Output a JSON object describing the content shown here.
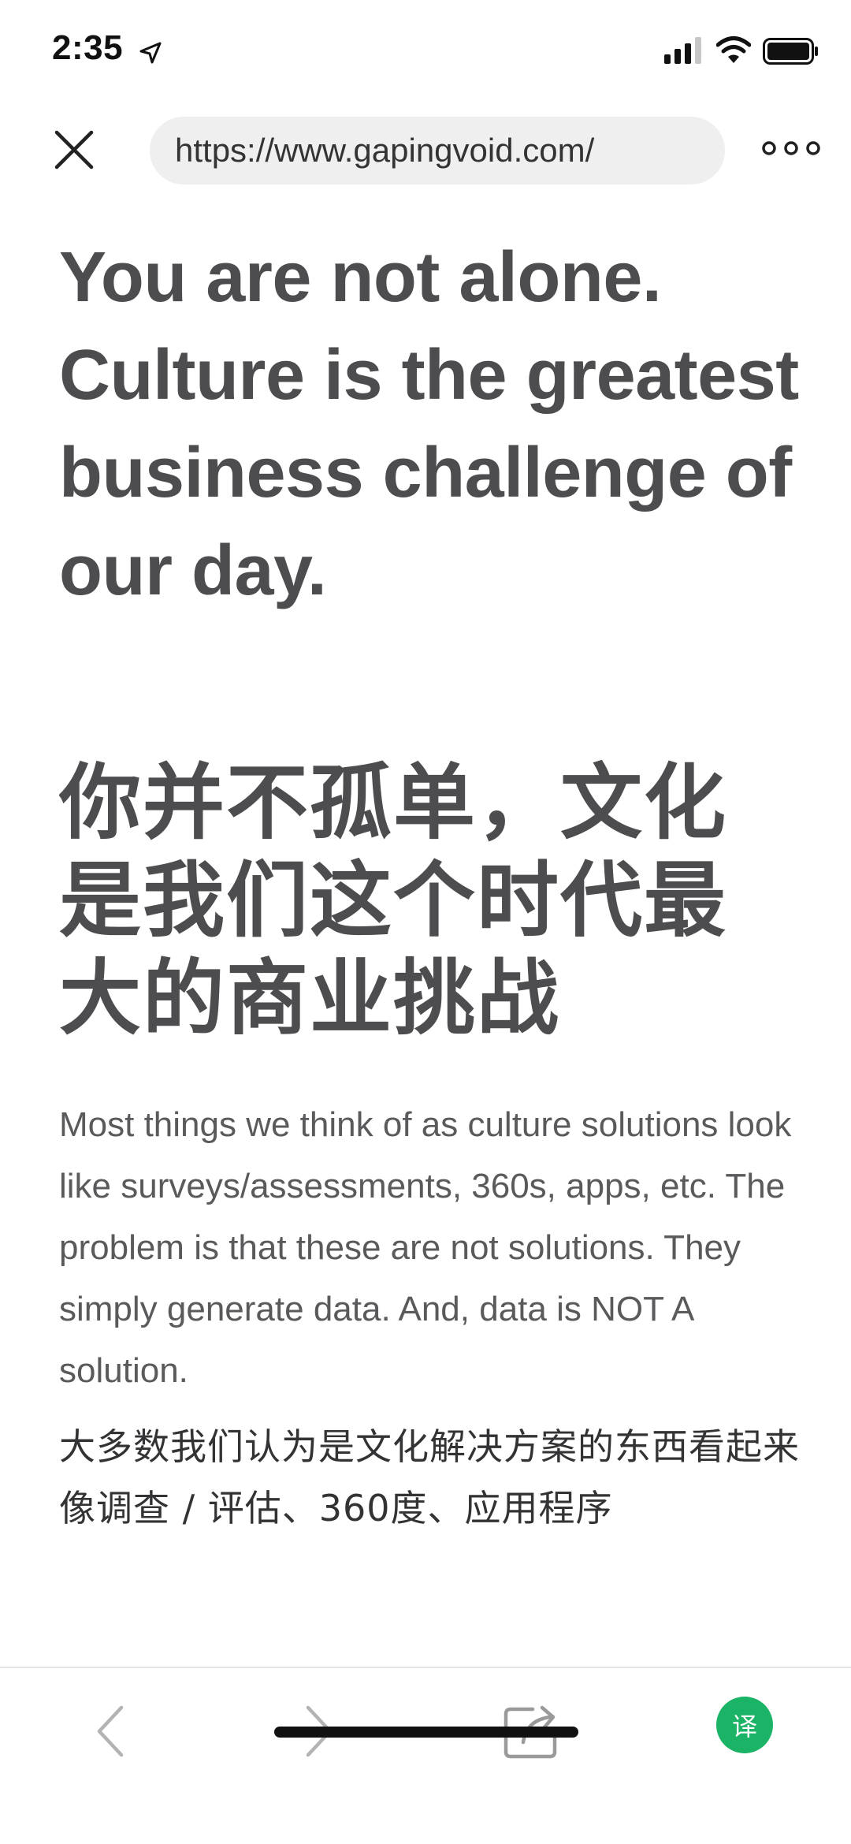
{
  "status_bar": {
    "time": "2:35",
    "icons": [
      "location-arrow-icon",
      "signal-icon",
      "wifi-icon",
      "battery-icon"
    ]
  },
  "browser": {
    "url": "https://www.gapingvoid.com/",
    "close_icon": "close-icon",
    "more_icon": "more-dots-icon"
  },
  "content": {
    "headline_en": "You are not alone. Culture is the greatest business challenge of our day.",
    "headline_zh": "你并不孤单，文化是我们这个时代最大的商业挑战",
    "paragraph_en": "Most things we think of as culture solutions look like surveys/assessments, 360s, apps, etc. The problem is that these are not solutions. They simply generate data. And, data is NOT A solution.",
    "paragraph_zh": "大多数我们认为是文化解决方案的东西看起来像调查 / 评估、360度、应用程序"
  },
  "toolbar": {
    "back_icon": "chevron-left-icon",
    "forward_icon": "chevron-right-icon",
    "share_icon": "share-icon",
    "translate_label": "译",
    "translate_color": "#1bb365"
  }
}
